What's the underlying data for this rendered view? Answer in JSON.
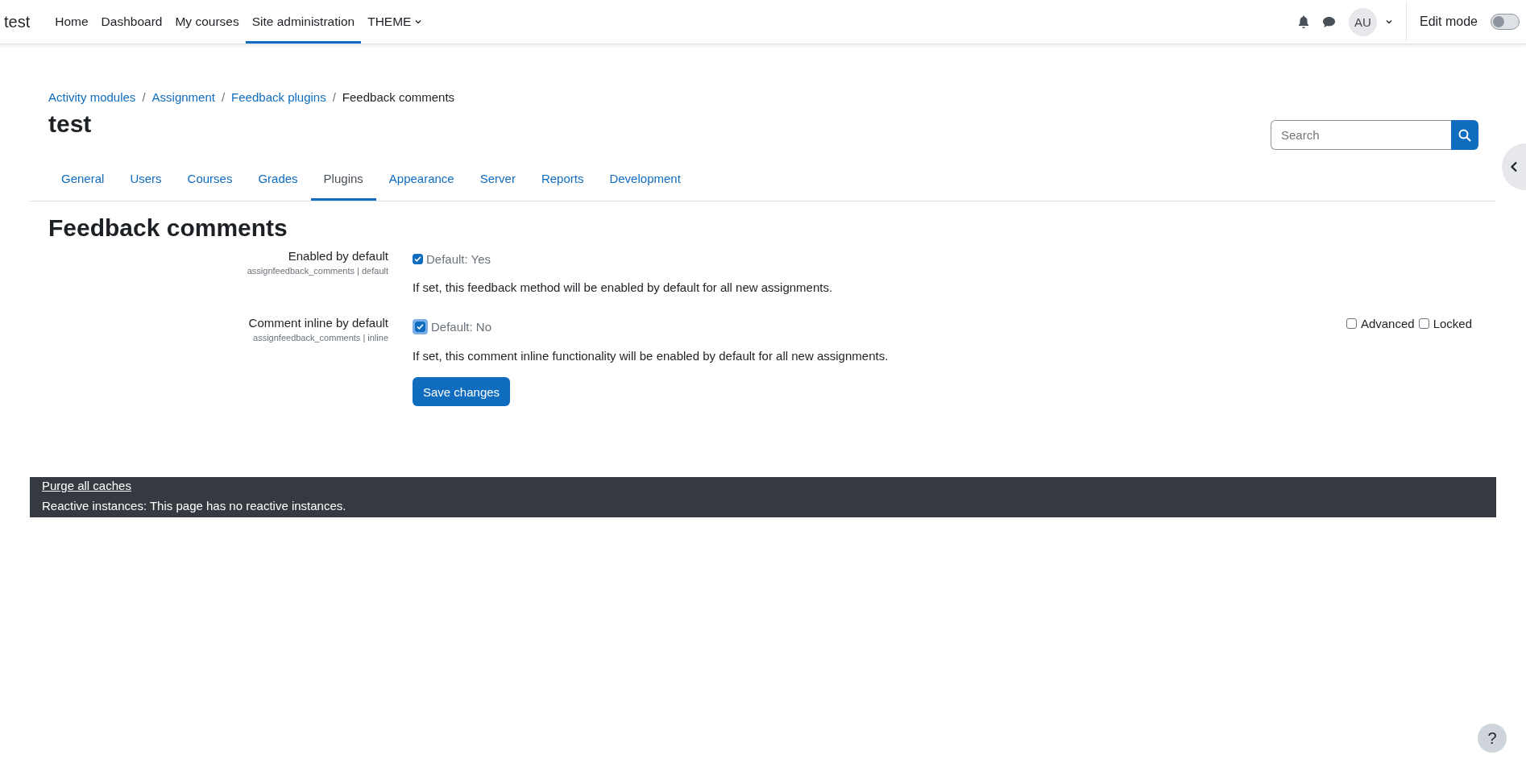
{
  "navbar": {
    "brand": "test",
    "items": [
      {
        "label": "Home",
        "selected": false
      },
      {
        "label": "Dashboard",
        "selected": false
      },
      {
        "label": "My courses",
        "selected": false
      },
      {
        "label": "Site administration",
        "selected": true
      },
      {
        "label": "THEME",
        "selected": false,
        "dropdown": true
      }
    ],
    "avatar": "AU",
    "edit_mode": {
      "label": "Edit mode",
      "on": false
    }
  },
  "breadcrumb": {
    "separator": "/",
    "items": [
      "Activity modules",
      "Assignment",
      "Feedback plugins",
      "Feedback comments"
    ]
  },
  "page_title": "test",
  "search": {
    "placeholder": "Search"
  },
  "tabs": [
    {
      "label": "General",
      "selected": false
    },
    {
      "label": "Users",
      "selected": false
    },
    {
      "label": "Courses",
      "selected": false
    },
    {
      "label": "Grades",
      "selected": false
    },
    {
      "label": "Plugins",
      "selected": true
    },
    {
      "label": "Appearance",
      "selected": false
    },
    {
      "label": "Server",
      "selected": false
    },
    {
      "label": "Reports",
      "selected": false
    },
    {
      "label": "Development",
      "selected": false
    }
  ],
  "heading": "Feedback comments",
  "settings": [
    {
      "label": "Enabled by default",
      "name": "assignfeedback_comments | default",
      "checked": true,
      "focused": false,
      "default": "Default: Yes",
      "description": "If set, this feedback method will be enabled by default for all new assignments."
    },
    {
      "label": "Comment inline by default",
      "name": "assignfeedback_comments | inline",
      "checked": true,
      "focused": true,
      "default": "Default: No",
      "description": "If set, this comment inline functionality will be enabled by default for all new assignments.",
      "flags": [
        {
          "label": "Advanced",
          "checked": false
        },
        {
          "label": "Locked",
          "checked": false
        }
      ]
    }
  ],
  "save_button": "Save changes",
  "footer": {
    "link": "Purge all caches",
    "text": "Reactive instances: This page has no reactive instances."
  },
  "help_button": "?"
}
